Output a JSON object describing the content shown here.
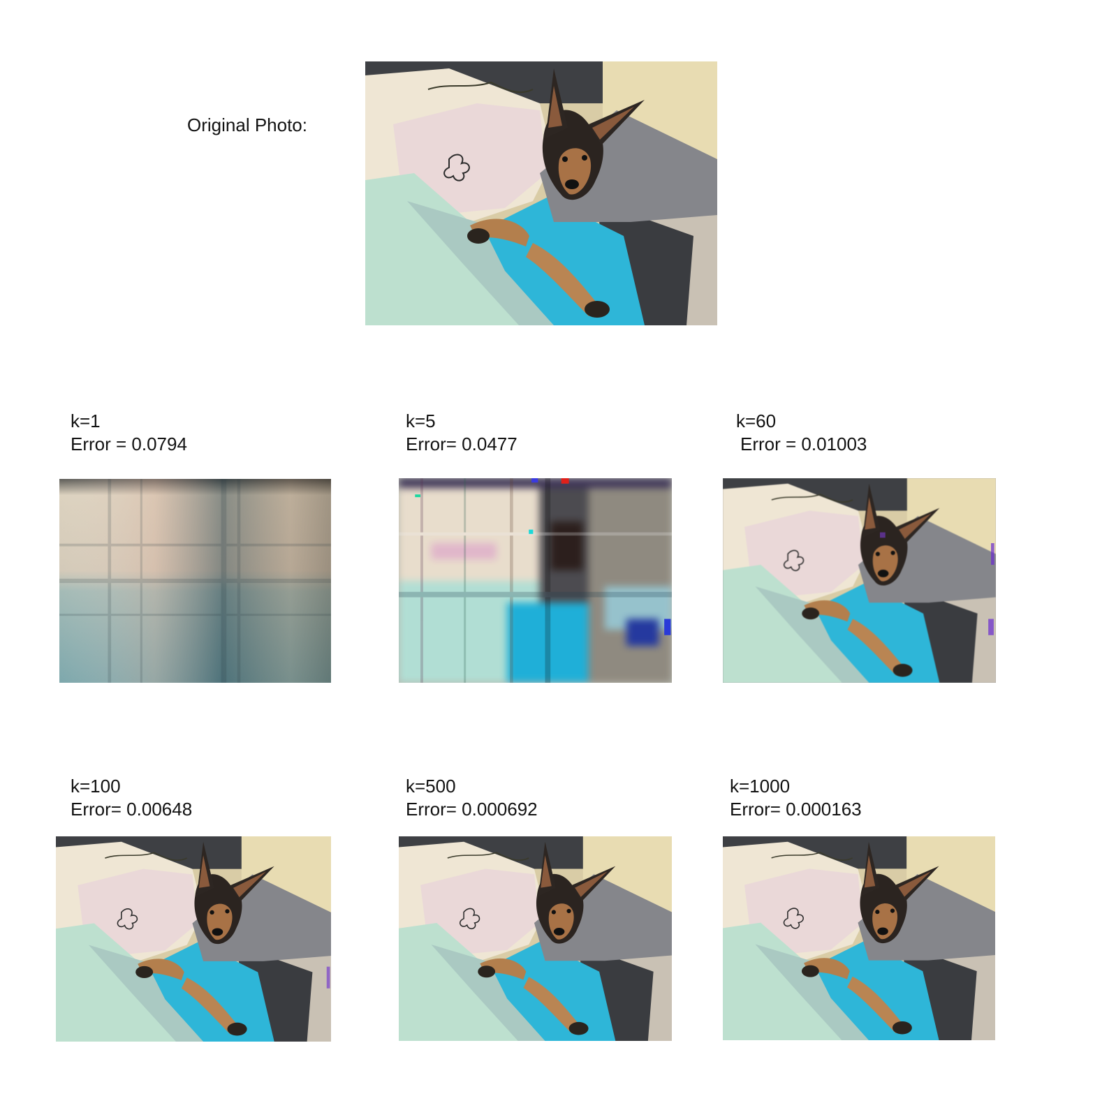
{
  "original": {
    "label": "Original Photo:"
  },
  "panels": [
    {
      "k_label": "k=1",
      "error_label": "Error = 0.0794"
    },
    {
      "k_label": "k=5",
      "error_label": "Error= 0.0477"
    },
    {
      "k_label": "k=60",
      "error_label": "Error = 0.01003"
    },
    {
      "k_label": "k=100",
      "error_label": "Error= 0.00648"
    },
    {
      "k_label": "k=500",
      "error_label": "Error= 0.000692"
    },
    {
      "k_label": "k=1000",
      "error_label": "Error= 0.000163"
    }
  ]
}
